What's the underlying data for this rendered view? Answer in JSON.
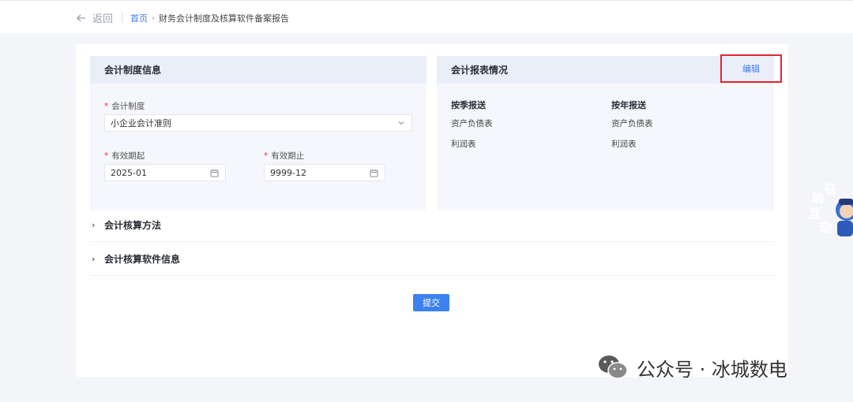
{
  "nav": {
    "back_label": "返回",
    "breadcrumb_home": "首页",
    "breadcrumb_current": "财务会计制度及核算软件备案报告"
  },
  "left_panel": {
    "title": "会计制度信息",
    "system_label": "会计制度",
    "system_value": "小企业会计准则",
    "start_label": "有效期起",
    "start_value": "2025-01",
    "end_label": "有效期止",
    "end_value": "9999-12"
  },
  "right_panel": {
    "title": "会计报表情况",
    "edit_label": "编辑",
    "quarterly_title": "按季报送",
    "quarterly_items": [
      "资产负债表",
      "利润表"
    ],
    "annual_title": "按年报送",
    "annual_items": [
      "资产负债表",
      "利润表"
    ]
  },
  "sections": {
    "method_title": "会计核算方法",
    "software_title": "会计核算软件信息"
  },
  "submit_label": "提交",
  "float_widget": {
    "chars": [
      "征",
      "纳",
      "互",
      "动"
    ]
  },
  "watermark": {
    "text": "公众号 · 冰城数电"
  },
  "colors": {
    "primary": "#3b82f0",
    "highlight_border": "#e0262e",
    "required": "#e23b3b"
  },
  "icons": [
    "arrow-left-icon",
    "chevron-down-icon",
    "calendar-icon",
    "chevron-right-icon",
    "wechat-icon"
  ]
}
